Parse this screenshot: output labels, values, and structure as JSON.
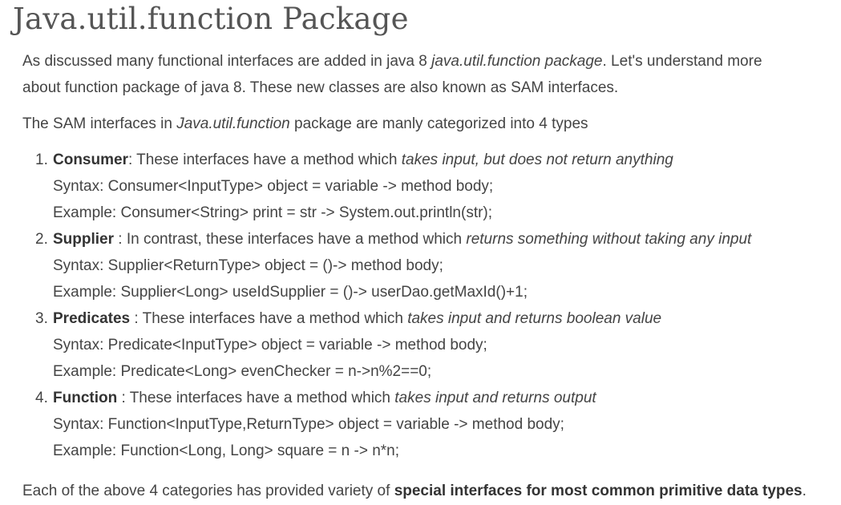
{
  "title": "Java.util.function Package",
  "intro": {
    "text_before": "As discussed many functional interfaces are added in java 8 ",
    "italic": "java.util.function package",
    "text_after_line1": ". Let's understand more",
    "line2": "about function package of java 8. These new classes are also known as SAM interfaces."
  },
  "categories_intro": {
    "text_before": "The SAM interfaces in ",
    "italic": "Java.util.function",
    "text_after": " package are manly categorized into 4 types"
  },
  "items": [
    {
      "number": "1.",
      "name": "Consumer",
      "separator": ": These interfaces have a method which ",
      "description": "takes input, but does not return anything",
      "syntax": "Syntax: Consumer<InputType> object = variable -> method body;",
      "example": "Example: Consumer<String> print = str -> System.out.println(str);"
    },
    {
      "number": "2.",
      "name": "Supplier",
      "separator": " : In contrast, these interfaces have a method which ",
      "description": "returns something without taking any input",
      "syntax": "Syntax: Supplier<ReturnType> object = ()-> method body;",
      "example": "Example: Supplier<Long> useIdSupplier = ()-> userDao.getMaxId()+1;"
    },
    {
      "number": "3.",
      "name": "Predicates",
      "separator": " : These interfaces have a method which ",
      "description": "takes input and returns boolean value",
      "syntax": "Syntax: Predicate<InputType> object = variable -> method body;",
      "example": "Example: Predicate<Long> evenChecker = n->n%2==0;"
    },
    {
      "number": "4.",
      "name": "Function",
      "separator": " : These interfaces have a method which ",
      "description": "takes input and returns output",
      "syntax": "Syntax: Function<InputType,ReturnType> object = variable -> method body;",
      "example": "Example: Function<Long, Long> square = n -> n*n;"
    }
  ],
  "closing": {
    "text_before": "Each of the above 4 categories has provided variety of ",
    "bold": "special interfaces for most common primitive data types",
    "text_after": "."
  }
}
